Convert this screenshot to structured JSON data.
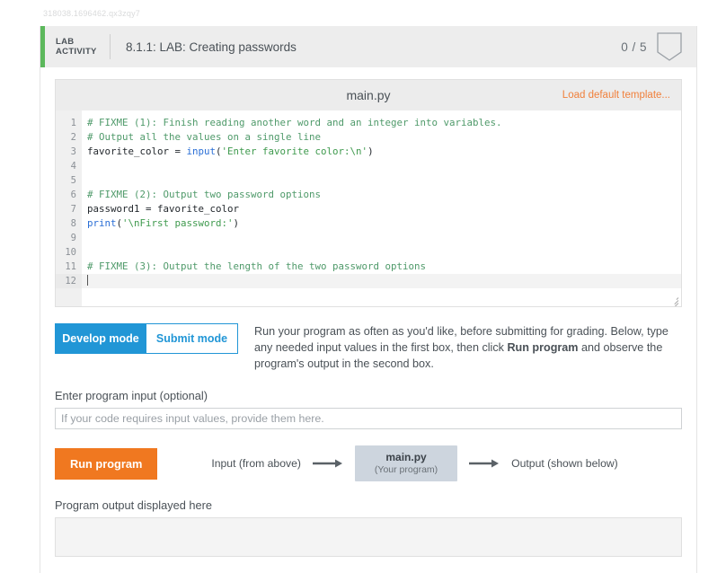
{
  "page": {
    "reference_id": "318038.1696462.qx3zqy7"
  },
  "activity": {
    "badge_line1": "LAB",
    "badge_line2": "ACTIVITY",
    "title": "8.1.1: LAB: Creating passwords",
    "score": "0 / 5"
  },
  "editor": {
    "filename": "main.py",
    "load_template_label": "Load default template...",
    "lines": [
      {
        "n": "1",
        "tokens": [
          {
            "t": "comment",
            "s": "# FIXME (1): Finish reading another word and an integer into variables."
          }
        ]
      },
      {
        "n": "2",
        "tokens": [
          {
            "t": "comment",
            "s": "# Output all the values on a single line"
          }
        ]
      },
      {
        "n": "3",
        "tokens": [
          {
            "t": "plain",
            "s": "favorite_color = "
          },
          {
            "t": "fn",
            "s": "input"
          },
          {
            "t": "plain",
            "s": "("
          },
          {
            "t": "str",
            "s": "'Enter favorite color:\\n'"
          },
          {
            "t": "plain",
            "s": ")"
          }
        ]
      },
      {
        "n": "4",
        "tokens": []
      },
      {
        "n": "5",
        "tokens": []
      },
      {
        "n": "6",
        "tokens": [
          {
            "t": "comment",
            "s": "# FIXME (2): Output two password options"
          }
        ]
      },
      {
        "n": "7",
        "tokens": [
          {
            "t": "plain",
            "s": "password1 = favorite_color"
          }
        ]
      },
      {
        "n": "8",
        "tokens": [
          {
            "t": "fn",
            "s": "print"
          },
          {
            "t": "plain",
            "s": "("
          },
          {
            "t": "str",
            "s": "'\\nFirst password:'"
          },
          {
            "t": "plain",
            "s": ")"
          }
        ]
      },
      {
        "n": "9",
        "tokens": []
      },
      {
        "n": "10",
        "tokens": []
      },
      {
        "n": "11",
        "tokens": [
          {
            "t": "comment",
            "s": "# FIXME (3): Output the length of the two password options"
          }
        ]
      },
      {
        "n": "12",
        "tokens": [],
        "active": true,
        "caret": true
      }
    ]
  },
  "modes": {
    "develop_label": "Develop mode",
    "submit_label": "Submit mode",
    "active": "develop",
    "description_part1": "Run your program as often as you'd like, before submitting for grading. Below, type any needed input values in the first box, then click ",
    "description_bold": "Run program",
    "description_part2": " and observe the program's output in the second box."
  },
  "input_section": {
    "label": "Enter program input (optional)",
    "placeholder": "If your code requires input values, provide them here.",
    "value": ""
  },
  "run_section": {
    "run_button_label": "Run program",
    "flow_input_label": "Input (from above)",
    "program_name": "main.py",
    "program_sub": "(Your program)",
    "flow_output_label": "Output (shown below)"
  },
  "output_section": {
    "label": "Program output displayed here",
    "value": ""
  },
  "colors": {
    "accent_green": "#5cb85c",
    "accent_blue": "#2196d6",
    "accent_orange": "#f07820",
    "link_orange": "#f0803c"
  }
}
